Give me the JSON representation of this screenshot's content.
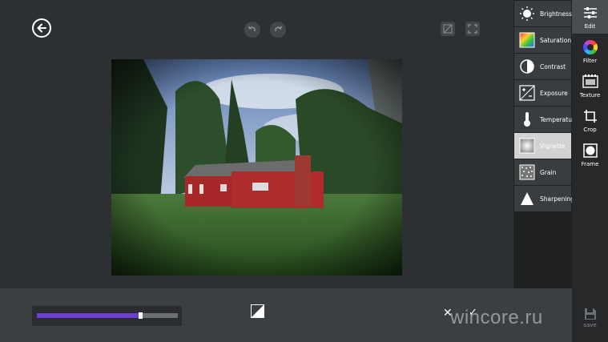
{
  "colors": {
    "background": "#2d3033",
    "bottom_bar": "#3c3f42",
    "panel": "#3a3d40",
    "active_item": "#d2d2d2",
    "slider_fill": "#6a3fd1",
    "tools_bg": "#26282a"
  },
  "toolbar": {
    "back_icon": "back-arrow-icon",
    "undo_icon": "undo-icon",
    "redo_icon": "redo-icon",
    "original_icon": "compare-original-icon",
    "fullscreen_icon": "fullscreen-icon"
  },
  "adjustments": [
    {
      "label": "Brightness",
      "icon": "brightness-icon",
      "active": false
    },
    {
      "label": "Saturation",
      "icon": "saturation-icon",
      "active": false
    },
    {
      "label": "Contrast",
      "icon": "contrast-icon",
      "active": false
    },
    {
      "label": "Exposure",
      "icon": "exposure-icon",
      "active": false
    },
    {
      "label": "Temperature",
      "icon": "thermometer-icon",
      "active": false
    },
    {
      "label": "Vignette",
      "icon": "vignette-icon",
      "active": true
    },
    {
      "label": "Grain",
      "icon": "grain-icon",
      "active": false
    },
    {
      "label": "Sharpening",
      "icon": "sharpening-icon",
      "active": false
    }
  ],
  "tools": [
    {
      "label": "Edit",
      "icon": "sliders-icon",
      "active": true
    },
    {
      "label": "Filter",
      "icon": "color-wheel-icon",
      "active": false
    },
    {
      "label": "Texture",
      "icon": "film-icon",
      "active": false
    },
    {
      "label": "Crop",
      "icon": "crop-icon",
      "active": false
    },
    {
      "label": "Frame",
      "icon": "frame-icon",
      "active": false
    }
  ],
  "save": {
    "label": "save",
    "icon": "floppy-disk-icon"
  },
  "slider": {
    "value": 0.74
  },
  "bottom": {
    "cancel_glyph": "✕",
    "apply_glyph": "✓"
  },
  "watermark": "wincore.ru"
}
